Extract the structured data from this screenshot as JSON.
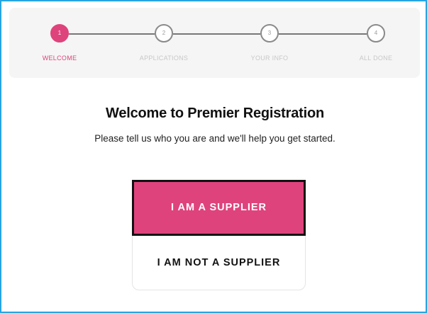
{
  "stepper": {
    "steps": [
      {
        "number": "1",
        "label": "WELCOME",
        "active": true
      },
      {
        "number": "2",
        "label": "APPLICATIONS",
        "active": false
      },
      {
        "number": "3",
        "label": "YOUR INFO",
        "active": false
      },
      {
        "number": "4",
        "label": "ALL DONE",
        "active": false
      }
    ],
    "colors": {
      "active": "#df437c",
      "inactive_label": "#c8c8c8",
      "line": "#777777"
    }
  },
  "welcome": {
    "title": "Welcome to Premier Registration",
    "subtitle": "Please tell us who you are and we'll help you get started."
  },
  "choices": {
    "supplier_label": "I AM A SUPPLIER",
    "not_supplier_label": "I AM NOT A SUPPLIER"
  },
  "colors": {
    "accent": "#df437c",
    "frame_border": "#27a6e1",
    "card_background": "#f5f5f5"
  }
}
